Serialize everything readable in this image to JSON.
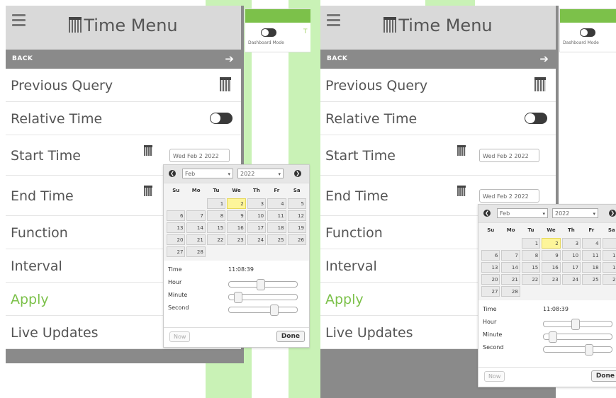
{
  "menu": {
    "title": "Time Menu",
    "back_label": "BACK",
    "back_arrow": "➔",
    "items": [
      {
        "label": "Previous Query"
      },
      {
        "label": "Relative Time"
      },
      {
        "label": "Start Time"
      },
      {
        "label": "End Time"
      },
      {
        "label": "Function"
      },
      {
        "label": "Interval"
      },
      {
        "label": "Apply"
      },
      {
        "label": "Live Updates"
      }
    ],
    "start_date_value": "Wed Feb 2 2022",
    "end_date_value": "Wed Feb 2 2022",
    "apply_color": "#7cc14a"
  },
  "dashboard": {
    "mode_label": "Dashboard Mode",
    "extra_label": "T"
  },
  "picker": {
    "prev_icon": "❮",
    "next_icon": "❯",
    "month": "Feb",
    "year": "2022",
    "dow": [
      "Su",
      "Mo",
      "Tu",
      "We",
      "Th",
      "Fr",
      "Sa"
    ],
    "weeks": [
      [
        "",
        "",
        "1",
        "2",
        "3",
        "4",
        "5"
      ],
      [
        "6",
        "7",
        "8",
        "9",
        "10",
        "11",
        "12"
      ],
      [
        "13",
        "14",
        "15",
        "16",
        "17",
        "18",
        "19"
      ],
      [
        "20",
        "21",
        "22",
        "23",
        "24",
        "25",
        "26"
      ],
      [
        "27",
        "28",
        "",
        "",
        "",
        "",
        ""
      ]
    ],
    "today": "2",
    "time_label": "Time",
    "time_value": "11:08:39",
    "hour_label": "Hour",
    "minute_label": "Minute",
    "second_label": "Second",
    "hour_fraction": 0.46,
    "minute_fraction": 0.13,
    "second_fraction": 0.66,
    "now_label": "Now",
    "done_label": "Done"
  },
  "colors": {
    "accent_green": "#7cc14a",
    "highlight_yellow": "#fdf59a",
    "header_gray": "#d9d9d9",
    "bar_gray": "#8a8a8a"
  }
}
